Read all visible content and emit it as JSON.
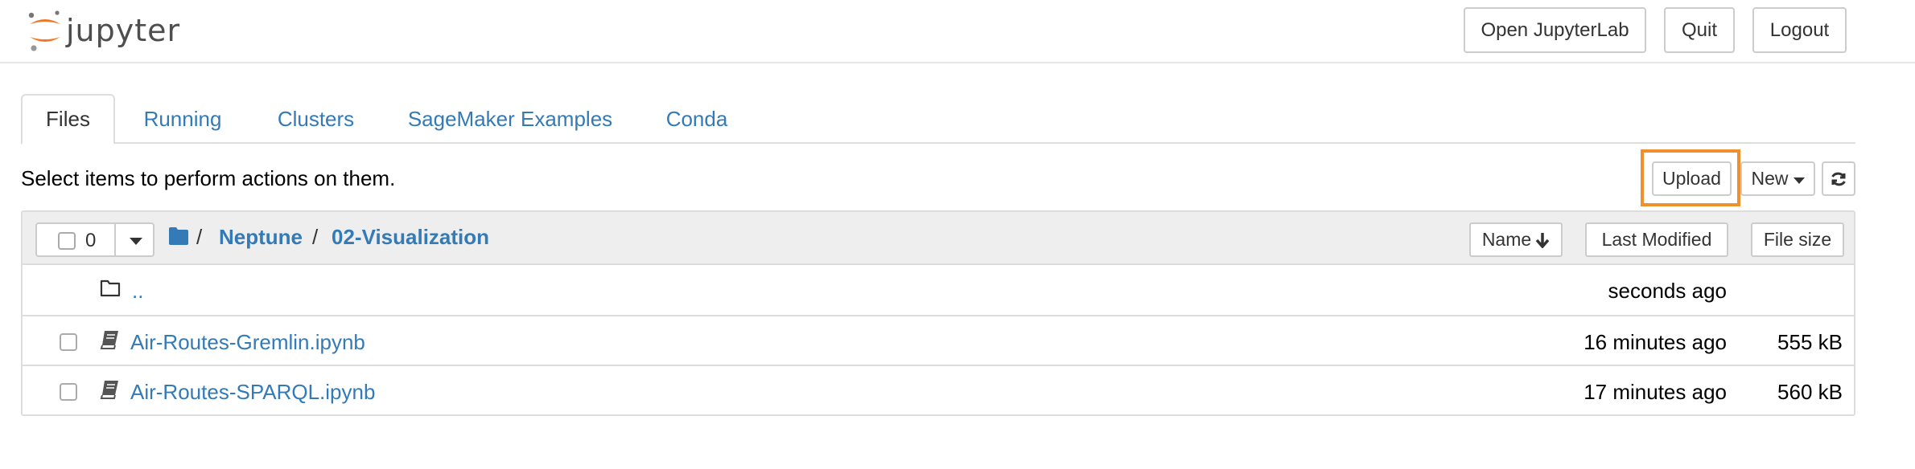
{
  "header": {
    "logo_text": "jupyter",
    "buttons": {
      "open_jupyterlab": "Open JupyterLab",
      "quit": "Quit",
      "logout": "Logout"
    }
  },
  "tabs": [
    {
      "label": "Files",
      "active": true
    },
    {
      "label": "Running",
      "active": false
    },
    {
      "label": "Clusters",
      "active": false
    },
    {
      "label": "SageMaker Examples",
      "active": false
    },
    {
      "label": "Conda",
      "active": false
    }
  ],
  "toolbar": {
    "instructions": "Select items to perform actions on them.",
    "upload_label": "Upload",
    "new_label": "New",
    "refresh_icon": "refresh-icon",
    "highlight_color": "#ef8f2e"
  },
  "file_list": {
    "selected_count": "0",
    "breadcrumb": [
      "Neptune",
      "02-Visualization"
    ],
    "breadcrumb_separator": "/",
    "sort_buttons": {
      "name": "Name",
      "last_modified": "Last Modified",
      "file_size": "File size"
    },
    "rows": [
      {
        "name": "..",
        "type": "folder",
        "icon": "folder-open-icon",
        "modified": "seconds ago",
        "size": ""
      },
      {
        "name": "Air-Routes-Gremlin.ipynb",
        "type": "notebook",
        "icon": "notebook-icon",
        "modified": "16 minutes ago",
        "size": "555 kB"
      },
      {
        "name": "Air-Routes-SPARQL.ipynb",
        "type": "notebook",
        "icon": "notebook-icon",
        "modified": "17 minutes ago",
        "size": "560 kB"
      }
    ]
  },
  "colors": {
    "link": "#337ab7",
    "jupyter_orange": "#f37726",
    "border": "#dddddd"
  }
}
